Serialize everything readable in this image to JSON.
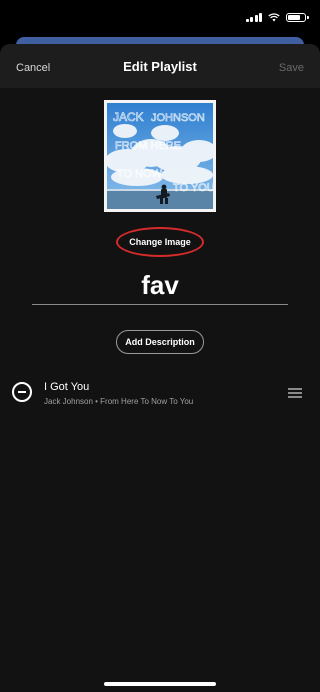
{
  "nav": {
    "cancel_label": "Cancel",
    "title": "Edit Playlist",
    "save_label": "Save"
  },
  "cover": {
    "icon": "album-cover-image",
    "art_text": [
      "JACK",
      "JOHNSON",
      "FROM HERE",
      "TO NOW",
      "TO YOU"
    ]
  },
  "change_image_label": "Change Image",
  "playlist_name": "fav",
  "add_description_label": "Add Description",
  "tracks": [
    {
      "title": "I Got You",
      "subtitle": "Jack Johnson • From Here To Now To You",
      "remove_icon": "minus-circle-icon",
      "drag_icon": "drag-handle-icon"
    }
  ],
  "colors": {
    "background": "#121212",
    "nav_background": "#1d1d1d",
    "highlight_ring": "#d52b2b",
    "secondary_text": "#a0a0a0"
  }
}
